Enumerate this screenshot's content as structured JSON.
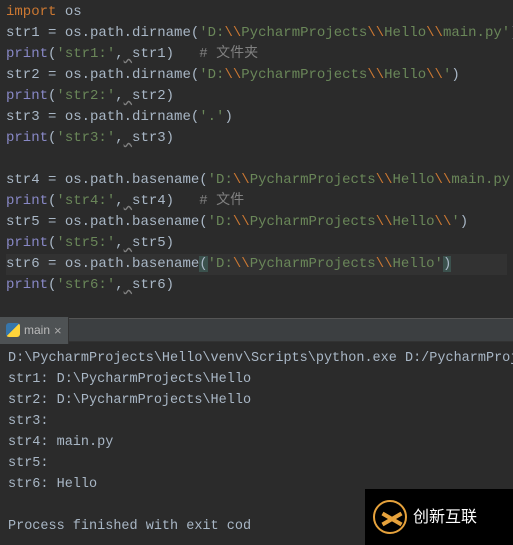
{
  "editor": {
    "lines": [
      {
        "tokens": [
          {
            "t": "kw",
            "v": "import"
          },
          {
            "t": "sp",
            "v": " "
          },
          {
            "t": "id",
            "v": "os"
          }
        ]
      },
      {
        "tokens": [
          {
            "t": "id",
            "v": "str1 "
          },
          {
            "t": "op",
            "v": "= "
          },
          {
            "t": "id",
            "v": "os.path.dirname("
          },
          {
            "t": "str",
            "v": "'D:"
          },
          {
            "t": "esc",
            "v": "\\\\"
          },
          {
            "t": "str",
            "v": "PycharmProjects"
          },
          {
            "t": "esc",
            "v": "\\\\"
          },
          {
            "t": "str",
            "v": "Hello"
          },
          {
            "t": "esc",
            "v": "\\\\"
          },
          {
            "t": "str",
            "v": "main.py'"
          },
          {
            "t": "id",
            "v": ")"
          }
        ]
      },
      {
        "tokens": [
          {
            "t": "fn",
            "v": "print"
          },
          {
            "t": "id",
            "v": "("
          },
          {
            "t": "str",
            "v": "'str1:'"
          },
          {
            "t": "op",
            "v": ","
          },
          {
            "t": "typo",
            "v": " "
          },
          {
            "t": "id",
            "v": "str1)   "
          },
          {
            "t": "cmt",
            "v": "# 文件夹"
          }
        ]
      },
      {
        "tokens": [
          {
            "t": "id",
            "v": "str2 "
          },
          {
            "t": "op",
            "v": "= "
          },
          {
            "t": "id",
            "v": "os.path.dirname("
          },
          {
            "t": "str",
            "v": "'D:"
          },
          {
            "t": "esc",
            "v": "\\\\"
          },
          {
            "t": "str",
            "v": "PycharmProjects"
          },
          {
            "t": "esc",
            "v": "\\\\"
          },
          {
            "t": "str",
            "v": "Hello"
          },
          {
            "t": "esc",
            "v": "\\\\"
          },
          {
            "t": "str",
            "v": "'"
          },
          {
            "t": "id",
            "v": ")"
          }
        ]
      },
      {
        "tokens": [
          {
            "t": "fn",
            "v": "print"
          },
          {
            "t": "id",
            "v": "("
          },
          {
            "t": "str",
            "v": "'str2:'"
          },
          {
            "t": "op",
            "v": ","
          },
          {
            "t": "typo",
            "v": " "
          },
          {
            "t": "id",
            "v": "str2)"
          }
        ]
      },
      {
        "tokens": [
          {
            "t": "id",
            "v": "str3 "
          },
          {
            "t": "op",
            "v": "= "
          },
          {
            "t": "id",
            "v": "os.path.dirname("
          },
          {
            "t": "str",
            "v": "'.'"
          },
          {
            "t": "id",
            "v": ")"
          }
        ]
      },
      {
        "tokens": [
          {
            "t": "fn",
            "v": "print"
          },
          {
            "t": "id",
            "v": "("
          },
          {
            "t": "str",
            "v": "'str3:'"
          },
          {
            "t": "op",
            "v": ","
          },
          {
            "t": "typo",
            "v": " "
          },
          {
            "t": "id",
            "v": "str3)"
          }
        ]
      },
      {
        "tokens": []
      },
      {
        "tokens": [
          {
            "t": "id",
            "v": "str4 "
          },
          {
            "t": "op",
            "v": "= "
          },
          {
            "t": "id",
            "v": "os.path.basename("
          },
          {
            "t": "str",
            "v": "'D:"
          },
          {
            "t": "esc",
            "v": "\\\\"
          },
          {
            "t": "str",
            "v": "PycharmProjects"
          },
          {
            "t": "esc",
            "v": "\\\\"
          },
          {
            "t": "str",
            "v": "Hello"
          },
          {
            "t": "esc",
            "v": "\\\\"
          },
          {
            "t": "str",
            "v": "main.py'"
          },
          {
            "t": "id",
            "v": ")"
          }
        ]
      },
      {
        "tokens": [
          {
            "t": "fn",
            "v": "print"
          },
          {
            "t": "id",
            "v": "("
          },
          {
            "t": "str",
            "v": "'str4:'"
          },
          {
            "t": "op",
            "v": ","
          },
          {
            "t": "typo",
            "v": " "
          },
          {
            "t": "id",
            "v": "str4)   "
          },
          {
            "t": "cmt",
            "v": "# 文件"
          }
        ]
      },
      {
        "tokens": [
          {
            "t": "id",
            "v": "str5 "
          },
          {
            "t": "op",
            "v": "= "
          },
          {
            "t": "id",
            "v": "os.path.basename("
          },
          {
            "t": "str",
            "v": "'D:"
          },
          {
            "t": "esc",
            "v": "\\\\"
          },
          {
            "t": "str",
            "v": "PycharmProjects"
          },
          {
            "t": "esc",
            "v": "\\\\"
          },
          {
            "t": "str",
            "v": "Hello"
          },
          {
            "t": "esc",
            "v": "\\\\"
          },
          {
            "t": "str",
            "v": "'"
          },
          {
            "t": "id",
            "v": ")"
          }
        ]
      },
      {
        "tokens": [
          {
            "t": "fn",
            "v": "print"
          },
          {
            "t": "id",
            "v": "("
          },
          {
            "t": "str",
            "v": "'str5:'"
          },
          {
            "t": "op",
            "v": ","
          },
          {
            "t": "typo",
            "v": " "
          },
          {
            "t": "id",
            "v": "str5)"
          }
        ]
      },
      {
        "highlighted": true,
        "tokens": [
          {
            "t": "id",
            "v": "str6 "
          },
          {
            "t": "op",
            "v": "= "
          },
          {
            "t": "id",
            "v": "os.path.basename"
          },
          {
            "t": "paren",
            "v": "("
          },
          {
            "t": "str",
            "v": "'D:"
          },
          {
            "t": "esc",
            "v": "\\\\"
          },
          {
            "t": "str",
            "v": "PycharmProjects"
          },
          {
            "t": "esc",
            "v": "\\\\"
          },
          {
            "t": "str",
            "v": "Hello'"
          },
          {
            "t": "paren",
            "v": ")"
          }
        ]
      },
      {
        "tokens": [
          {
            "t": "fn",
            "v": "print"
          },
          {
            "t": "id",
            "v": "("
          },
          {
            "t": "str",
            "v": "'str6:'"
          },
          {
            "t": "op",
            "v": ","
          },
          {
            "t": "typo",
            "v": " "
          },
          {
            "t": "id",
            "v": "str6)"
          }
        ]
      }
    ]
  },
  "tab": {
    "label": "main",
    "close": "×"
  },
  "console_lines": [
    "D:\\PycharmProjects\\Hello\\venv\\Scripts\\python.exe D:/PycharmProj",
    "str1: D:\\PycharmProjects\\Hello",
    "str2: D:\\PycharmProjects\\Hello",
    "str3:",
    "str4: main.py",
    "str5:",
    "str6: Hello",
    "",
    "Process finished with exit cod"
  ],
  "watermark": "创新互联"
}
